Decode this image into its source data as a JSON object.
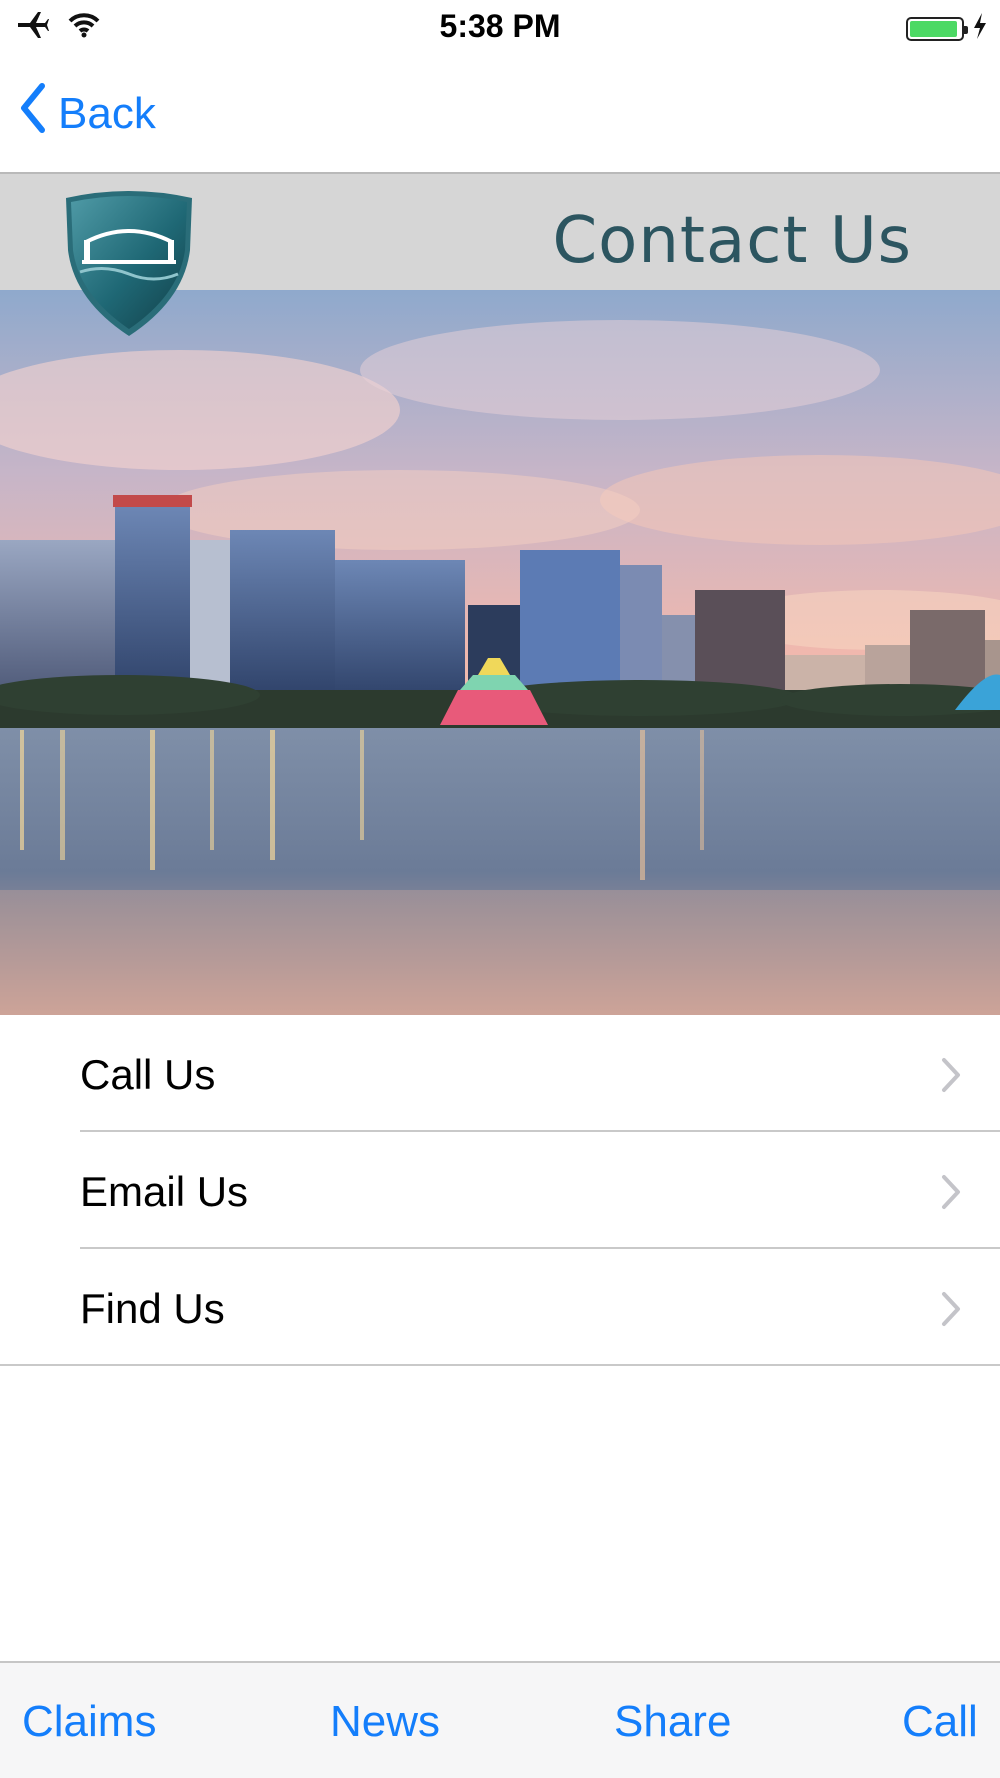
{
  "status": {
    "time": "5:38 PM",
    "icons": [
      "airplane-icon",
      "wifi-icon",
      "battery-icon",
      "charging-icon"
    ],
    "battery_level": 0.95
  },
  "nav": {
    "back_label": "Back",
    "accent": "#147efb"
  },
  "header": {
    "title": "Contact Us",
    "band_color": "#d6d6d6",
    "title_color": "#2c5560"
  },
  "menu": {
    "items": [
      {
        "label": "Call Us"
      },
      {
        "label": "Email Us"
      },
      {
        "label": "Find Us"
      }
    ]
  },
  "tabbar": {
    "items": [
      {
        "label": "Claims"
      },
      {
        "label": "News"
      },
      {
        "label": "Share"
      },
      {
        "label": "Call"
      }
    ]
  }
}
